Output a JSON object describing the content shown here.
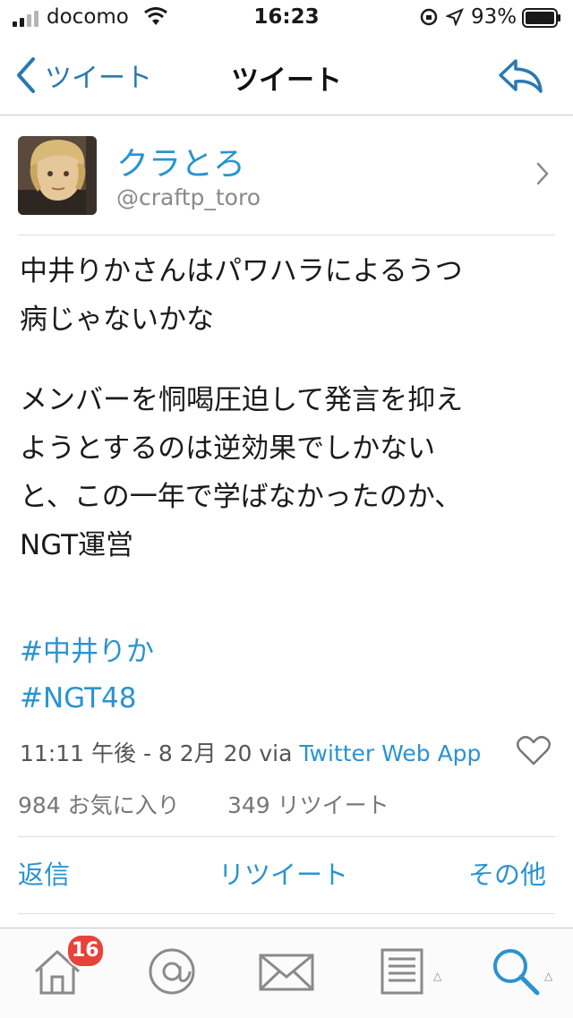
{
  "status_bar": {
    "carrier": "docomo",
    "time": "16:23",
    "battery_percent": "93%"
  },
  "nav": {
    "back_label": "ツイート",
    "title": "ツイート",
    "icons": [
      "chevron-left-icon",
      "reply-icon"
    ]
  },
  "user": {
    "display_name": "クラとろ",
    "handle": "@craftp_toro"
  },
  "tweet": {
    "paragraph1": "中井りかさんはパワハラによるうつ\n病じゃないかな",
    "paragraph2": "メンバーを恫喝圧迫して発言を抑え\nようとするのは逆効果でしかない\nと、この一年で学ばなかったのか、\nNGT運営",
    "hashtags": [
      "#中井りか",
      "#NGT48"
    ]
  },
  "meta": {
    "time_date": "11:11 午後 - 8 2月 20 via ",
    "client": "Twitter Web App"
  },
  "stats": {
    "favorites": "984 お気に入り",
    "retweets": "349 リツイート"
  },
  "actions": {
    "reply": "返信",
    "retweet": "リツイート",
    "more": "その他"
  },
  "tabbar": {
    "badge_count": "16",
    "icons": [
      "home-icon",
      "mentions-icon",
      "messages-icon",
      "lists-icon",
      "search-icon"
    ]
  },
  "colors": {
    "accent": "#2a93d0",
    "badge": "#e8423a"
  }
}
